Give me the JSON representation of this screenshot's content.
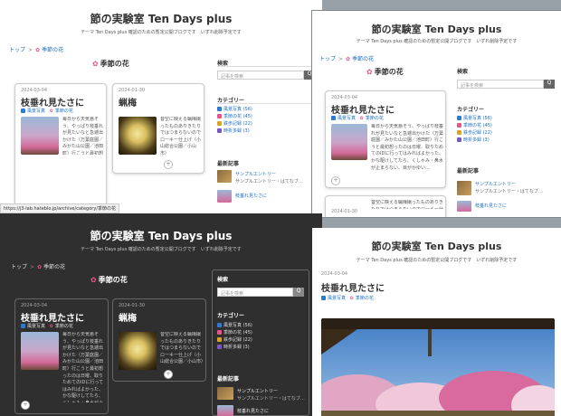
{
  "site": {
    "title": "節の実験室 Ten Days plus",
    "subtitle": "テーマ Ten Days plus 確認のための暫定公開ブログです　いずれ削除予定です"
  },
  "breadcrumb": {
    "home": "トップ",
    "separator": ">",
    "current": "季節の花"
  },
  "section_title": "季節の花",
  "posts": [
    {
      "date": "2024-03-04",
      "title": "枝垂れ見たさに",
      "categories": [
        "風景写真",
        "季節の花"
      ],
      "excerpt": "毎日から天気悪そう、やっぱり枝垂れが見たいなと急遽出かけた（万葉庭園／みかた山公園／池田町）行こうと最初想ったのは日曜、取りためてのIDに行ってはみればよかった、かな駆けしてたら、くしゃみ・鼻水が止まらない、目がかゆい…"
    },
    {
      "date": "2024-01-30",
      "title": "蝋梅",
      "categories": [],
      "excerpt": "昔空に映える蝋梅撮ったものありきたりではつまらないのでローキー仕上げ（小山総合公園／小山市）"
    }
  ],
  "sidebar": {
    "search_heading": "検索",
    "search_placeholder": "記事を検索",
    "search_button": "Q",
    "category_heading": "カテゴリー",
    "categories": [
      {
        "label": "風景写真 (56)",
        "color": "#2a7bd5"
      },
      {
        "label": "季節の花 (45)",
        "color": "#e8548a"
      },
      {
        "label": "鉄歩記録 (22)",
        "color": "#d9a520"
      },
      {
        "label": "時折多録 (3)",
        "color": "#7a55c8"
      }
    ],
    "recent_heading": "最新記事",
    "recent": [
      {
        "title": "サンプルエントリー",
        "subtitle": "サンプルエントリー・はてなブ…"
      },
      {
        "title": "枝垂れ見たさに"
      }
    ]
  },
  "status_url": "https://j3-lab.hateblo.jp/archive/category/季節の花",
  "more_label": "+",
  "icons": {
    "flower": "cherry-blossom-icon",
    "category": "folder-icon",
    "search": "search-icon"
  }
}
